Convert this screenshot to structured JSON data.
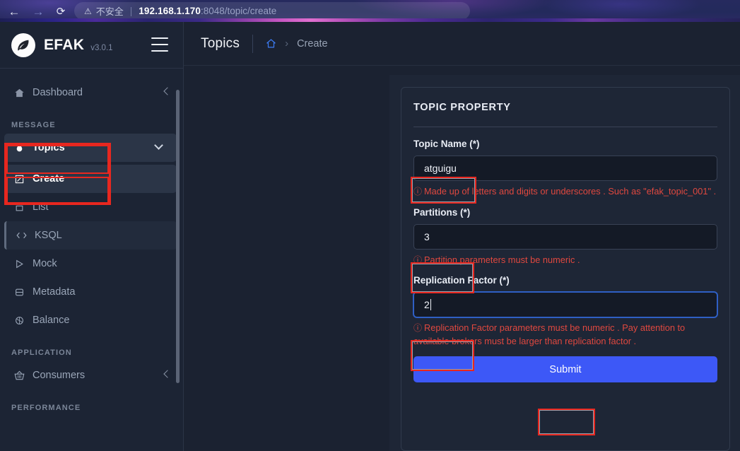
{
  "browser": {
    "back_icon": "←",
    "forward_icon": "→",
    "reload_icon": "⟳",
    "warning_icon": "⚠",
    "insecure_label": "不安全",
    "url_separator": "|",
    "url_host": "192.168.1.170",
    "url_path": ":8048/topic/create"
  },
  "sidebar": {
    "brand": {
      "name": "EFAK",
      "version": "v3.0.1",
      "logo_icon": "feather-logo-icon",
      "menu_icon": "hamburger-icon"
    },
    "dashboard": {
      "label": "Dashboard",
      "icon": "home-icon",
      "tail_icon": "chevron-left-icon"
    },
    "sections": [
      {
        "title": "MESSAGE",
        "items": [
          {
            "label": "Topics",
            "icon": "droplet-icon",
            "tail_icon": "chevron-down-icon",
            "state": "expanded"
          },
          {
            "label": "Create",
            "icon": "create-square-icon",
            "state": "active-sub"
          },
          {
            "label": "List",
            "icon": "list-icon",
            "state": "sub"
          },
          {
            "label": "KSQL",
            "icon": "code-icon",
            "state": "hover"
          },
          {
            "label": "Mock",
            "icon": "play-icon",
            "state": "normal"
          },
          {
            "label": "Metadata",
            "icon": "database-icon",
            "state": "normal"
          },
          {
            "label": "Balance",
            "icon": "balance-icon",
            "state": "normal"
          }
        ]
      },
      {
        "title": "APPLICATION",
        "items": [
          {
            "label": "Consumers",
            "icon": "basket-icon",
            "tail_icon": "chevron-left-icon",
            "state": "normal"
          }
        ]
      },
      {
        "title": "PERFORMANCE",
        "items": []
      }
    ]
  },
  "topbar": {
    "page_title": "Topics",
    "home_icon": "home-icon",
    "separator": "›",
    "breadcrumb_current": "Create"
  },
  "form": {
    "card_title": "TOPIC PROPERTY",
    "fields": [
      {
        "label": "Topic Name (*)",
        "value": "atguigu",
        "hint_icon": "ⓘ",
        "hint": "Made up of letters and digits or underscores . Such as \"efak_topic_001\" .",
        "focused": false
      },
      {
        "label": "Partitions (*)",
        "value": "3",
        "hint_icon": "ⓘ",
        "hint": "Partition parameters must be numeric .",
        "focused": false
      },
      {
        "label": "Replication Factor (*)",
        "value": "2",
        "hint_icon": "ⓘ",
        "hint": "Replication Factor parameters must be numeric . Pay attention to available brokers must be larger than replication factor .",
        "focused": true
      }
    ],
    "submit_label": "Submit"
  },
  "colors": {
    "annotation_red": "#e8271f",
    "submit_blue": "#3d58f7",
    "hint_red": "#e0483f",
    "focus_blue": "#2f5fc4",
    "sidebar_bg": "#1c2434",
    "content_bg": "#1b2231",
    "card_bg": "#1e2636"
  }
}
